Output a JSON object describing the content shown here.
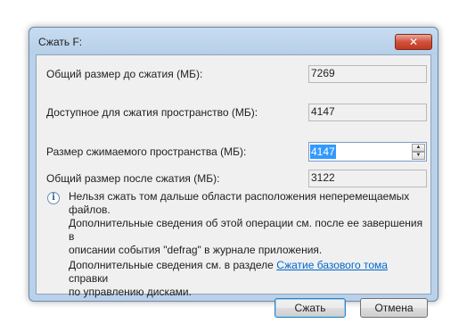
{
  "window": {
    "title": "Сжать F:",
    "close_label": "✕"
  },
  "fields": {
    "total_before_label": "Общий размер до сжатия (МБ):",
    "total_before_value": "7269",
    "available_label": "Доступное для сжатия пространство (МБ):",
    "available_value": "4147",
    "shrink_label": "Размер сжимаемого пространства (МБ):",
    "shrink_value": "4147",
    "total_after_label": "Общий размер после сжатия (МБ):",
    "total_after_value": "3122"
  },
  "info": {
    "icon": "info-icon",
    "line1": "Нельзя сжать том дальше области расположения неперемещаемых файлов.",
    "line2": "Дополнительные сведения об этой операции см. после ее завершения в",
    "line3": "описании события \"defrag\" в журнале приложения.",
    "more_prefix": "Дополнительные сведения см. в разделе ",
    "more_link": "Сжатие базового тома",
    "more_suffix": " справки",
    "more_line2": "по управлению дисками."
  },
  "buttons": {
    "shrink_label": "Сжать",
    "cancel_label": "Отмена"
  },
  "colors": {
    "frame": "#b9d1ea",
    "close": "#c23a22",
    "selection": "#3399ff",
    "link": "#0066cc"
  }
}
